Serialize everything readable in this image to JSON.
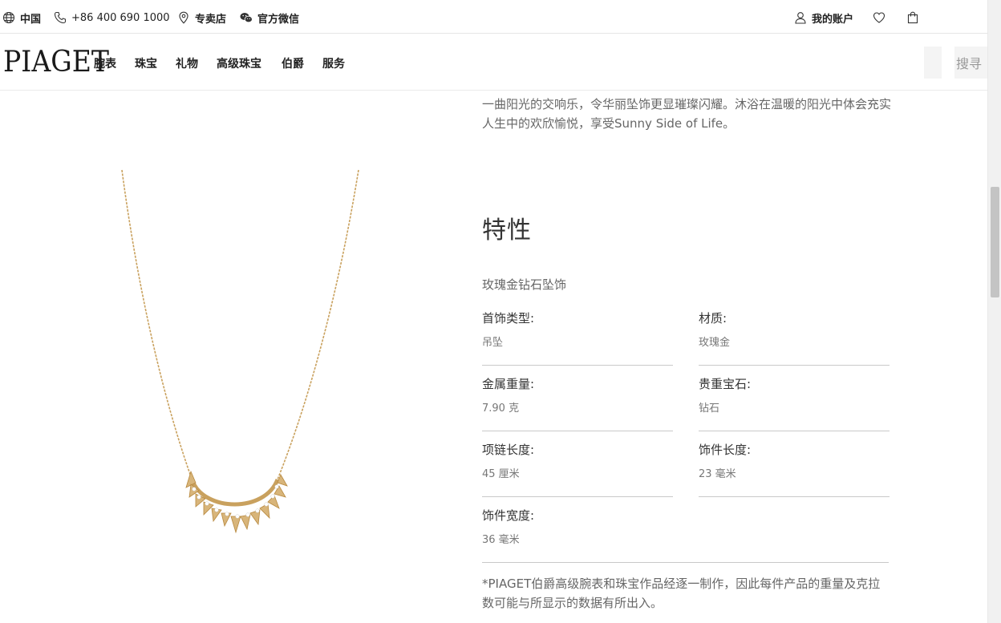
{
  "topbar": {
    "region": "中国",
    "phone": "+86 400 690 1000",
    "store": "专卖店",
    "wechat": "官方微信",
    "account": "我的账户"
  },
  "nav": {
    "logo": "PIAGET",
    "items": [
      "腕表",
      "珠宝",
      "礼物",
      "高级珠宝",
      "伯爵",
      "服务"
    ],
    "search_label": "搜寻"
  },
  "content": {
    "intro": "一曲阳光的交响乐，令华丽坠饰更显璀璨闪耀。沐浴在温暖的阳光中体会充实人生中的欢欣愉悦，享受Sunny Side of Life。",
    "section_title": "特性",
    "subtitle": "玫瑰金钻石坠饰",
    "specs": [
      {
        "label": "首饰类型:",
        "value": "吊坠"
      },
      {
        "label": "材质:",
        "value": "玫瑰金"
      },
      {
        "label": "金属重量:",
        "value": "7.90 克"
      },
      {
        "label": "贵重宝石:",
        "value": "钻石"
      },
      {
        "label": "项链长度:",
        "value": "45 厘米"
      },
      {
        "label": "饰件长度:",
        "value": "23 毫米"
      },
      {
        "label": "饰件宽度:",
        "value": "36 毫米"
      }
    ],
    "disclaimer": "*PIAGET伯爵高级腕表和珠宝作品经逐一制作，因此每件产品的重量及克拉数可能与所显示的数据有所出入。"
  },
  "colors": {
    "gold": "#c9a15e",
    "text_dark": "#222222",
    "text_muted": "#666666"
  }
}
